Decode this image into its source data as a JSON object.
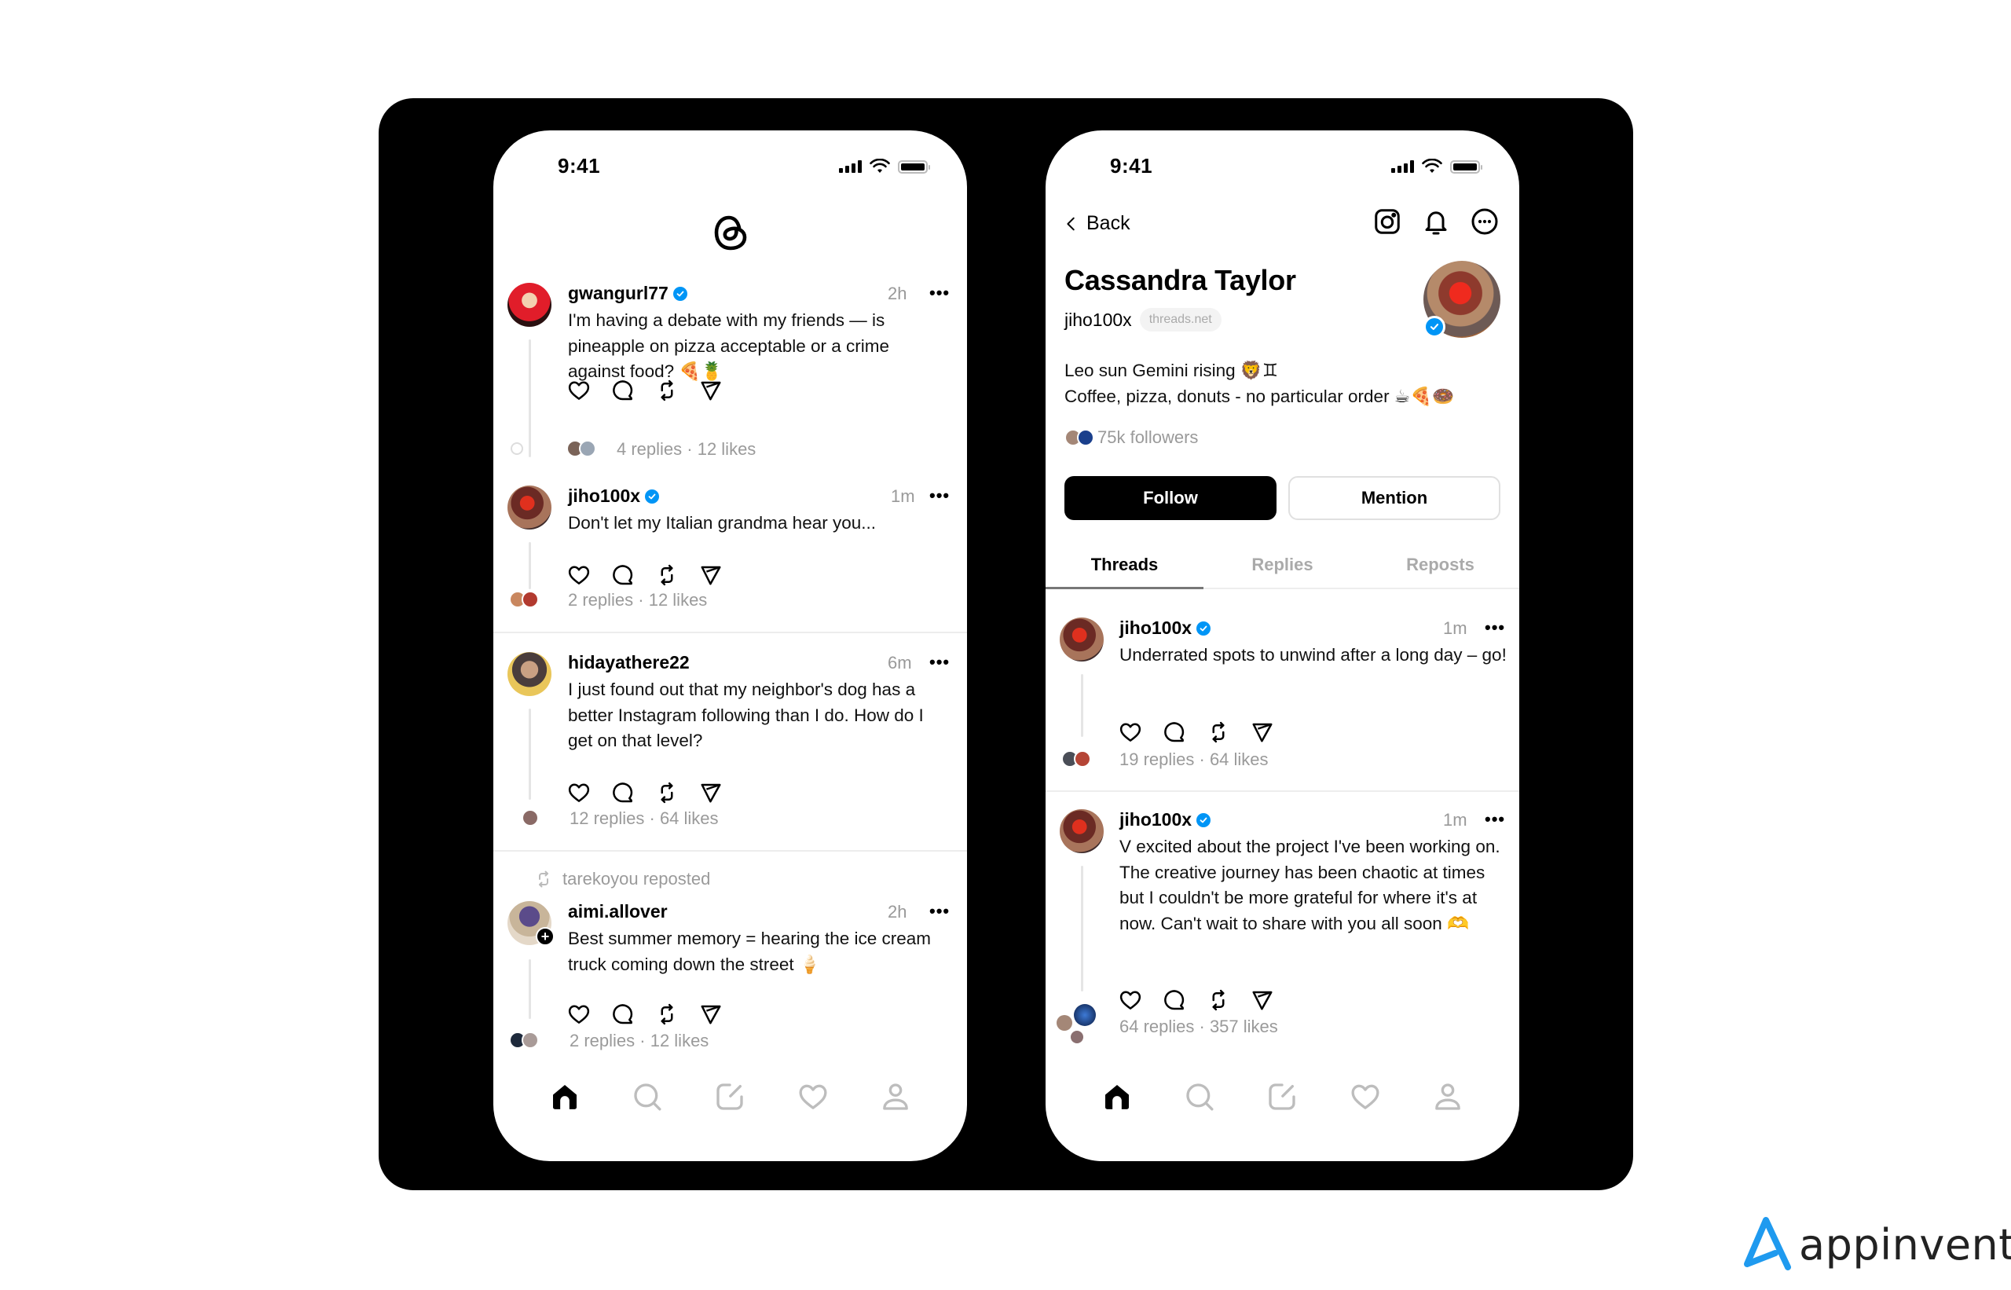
{
  "brand": {
    "name": "appinventiv",
    "accent": "#1f9aef"
  },
  "colors": {
    "verified": "#0095f6",
    "muted": "#9a9a9a"
  },
  "feed_screen": {
    "status_time": "9:41",
    "logo": "threads-logo",
    "posts": [
      {
        "username": "gwangurl77",
        "verified": true,
        "time": "2h",
        "text": "I'm having a debate with my friends — is pineapple on pizza acceptable or a crime against food? 🍕🍍",
        "stats": "4 replies · 12 likes"
      },
      {
        "username": "jiho100x",
        "verified": true,
        "time": "1m",
        "text": "Don't let my Italian grandma hear you...",
        "stats": "2 replies · 12 likes"
      },
      {
        "username": "hidayathere22",
        "verified": false,
        "time": "6m",
        "text": "I just found out that my neighbor's dog has a better Instagram following than I do. How do I get on that level?",
        "stats": "12 replies · 64 likes"
      },
      {
        "repost_label": "tarekoyou reposted",
        "username": "aimi.allover",
        "verified": false,
        "time": "2h",
        "text": "Best summer memory = hearing the ice cream truck coming down the street 🍦",
        "stats": "2 replies · 12 likes"
      }
    ],
    "more_label": "•••",
    "nav": [
      "home-icon",
      "search-icon",
      "compose-icon",
      "heart-icon",
      "profile-icon"
    ],
    "nav_active": "home-icon"
  },
  "profile_screen": {
    "status_time": "9:41",
    "back_label": "Back",
    "header_icons": [
      "instagram-icon",
      "bell-icon",
      "more-circle-icon"
    ],
    "name": "Cassandra Taylor",
    "handle": "jiho100x",
    "domain_pill": "threads.net",
    "bio_line1": "Leo sun Gemini rising 🦁♊",
    "bio_line2": "Coffee, pizza, donuts - no particular order ☕🍕🍩",
    "followers": "75k followers",
    "follow_label": "Follow",
    "mention_label": "Mention",
    "tabs": [
      {
        "label": "Threads",
        "active": true
      },
      {
        "label": "Replies",
        "active": false
      },
      {
        "label": "Reposts",
        "active": false
      }
    ],
    "posts": [
      {
        "username": "jiho100x",
        "verified": true,
        "time": "1m",
        "text": "Underrated spots to unwind after a long day – go!",
        "stats": "19 replies · 64 likes"
      },
      {
        "username": "jiho100x",
        "verified": true,
        "time": "1m",
        "text": "V excited about the project I've been working on. The creative journey has been chaotic at times but I couldn't be more grateful for where it's at now. Can't wait to share with you all soon 🫶",
        "stats": "64 replies · 357 likes"
      }
    ],
    "more_label": "•••",
    "nav": [
      "home-icon",
      "search-icon",
      "compose-icon",
      "heart-icon",
      "profile-icon"
    ],
    "nav_active": "home-icon"
  }
}
